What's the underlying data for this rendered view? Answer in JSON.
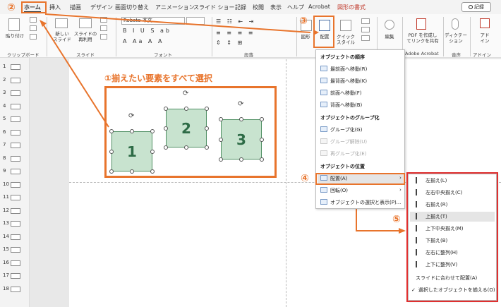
{
  "tabs": [
    "ホーム",
    "挿入",
    "描画",
    "デザイン",
    "画面切り替え",
    "アニメーション",
    "スライド ショー",
    "記録",
    "校閲",
    "表示",
    "ヘルプ",
    "Acrobat",
    "図形の書式"
  ],
  "record_button": "記録",
  "ribbon": {
    "paste": "貼り付け",
    "new_slide": "新しい\nスライド",
    "reuse_slide": "スライドの\n再利用",
    "font_name": "Roboto 本文",
    "shapes": "図形",
    "arrange": "配置",
    "quick_styles": "クイック\nスタイル",
    "editing": "編集",
    "pdf_share": "PDF を作成し\nてリンクを共有",
    "dictate": "ディクテー\nション",
    "addin": "アド\nイン",
    "groups": {
      "clipboard": "クリップボード",
      "slides": "スライド",
      "font": "フォント",
      "paragraph": "段落",
      "acrobat": "Adobe Acrobat",
      "voice": "音声",
      "addins": "アドイン"
    }
  },
  "thumbnails": [
    "1",
    "2",
    "3",
    "4",
    "5",
    "6",
    "7",
    "8",
    "9",
    "10",
    "11",
    "12",
    "13",
    "14",
    "15",
    "16",
    "17",
    "18"
  ],
  "slide": {
    "instruction": "①揃えたい要素をすべて選択",
    "shapes": [
      "1",
      "2",
      "3"
    ]
  },
  "callouts": [
    "②",
    "③",
    "④",
    "⑤"
  ],
  "arrange_menu": {
    "order_header": "オブジェクトの順序",
    "order_items": [
      "最前面へ移動(R)",
      "最背面へ移動(K)",
      "前面へ移動(F)",
      "背面へ移動(B)"
    ],
    "group_header": "オブジェクトのグループ化",
    "group_items": [
      "グループ化(G)",
      "グループ解除(U)",
      "再グループ化(E)"
    ],
    "position_header": "オブジェクトの位置",
    "position_items": [
      "配置(A)",
      "回転(O)",
      "オブジェクトの選択と表示(P)..."
    ]
  },
  "align_submenu": {
    "items": [
      "左揃え(L)",
      "左右中央揃え(C)",
      "右揃え(R)",
      "上揃え(T)",
      "上下中央揃え(M)",
      "下揃え(B)",
      "左右に整列(H)",
      "上下に整列(V)",
      "スライドに合わせて配置(A)",
      "選択したオブジェクトを揃える(O)"
    ]
  },
  "colors": {
    "accent": "#e8742c",
    "highlight_red": "#e03030",
    "shape_fill": "#c8e3cf",
    "shape_border": "#4f8f63"
  }
}
